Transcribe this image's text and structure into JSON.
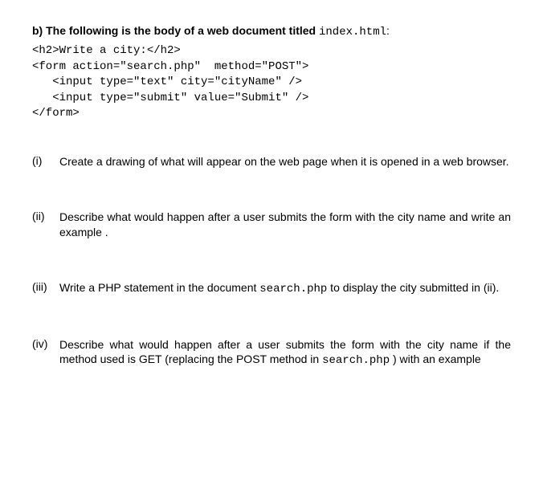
{
  "intro": {
    "part_label": "b)",
    "lead_text": "The following is the body of a web document titled ",
    "filename": "index.html",
    "colon": ":"
  },
  "code": {
    "line1": "<h2>Write a city:</h2>",
    "line2": "<form action=\"search.php\"  method=\"POST\">",
    "line3": "   <input type=\"text\" city=\"cityName\" />",
    "line4": "   <input type=\"submit\" value=\"Submit\" />",
    "line5": "</form>"
  },
  "questions": {
    "q1": {
      "marker": "(i)",
      "text": "Create a drawing of what will appear on the web page when it is opened in a web browser."
    },
    "q2": {
      "marker": "(ii)",
      "text": "Describe what would happen after a user submits the form with the city name and write an example ."
    },
    "q3": {
      "marker": "(iii)",
      "text_before": "Write a PHP statement in the document ",
      "code": "search.php",
      "text_after": " to display the city submitted in (ii)."
    },
    "q4": {
      "marker": "(iv)",
      "text_before": "Describe what would happen after a user submits the form with the city name if the method used is GET (replacing the POST method in ",
      "code": "search.php",
      "text_after": " ) with an example"
    }
  }
}
